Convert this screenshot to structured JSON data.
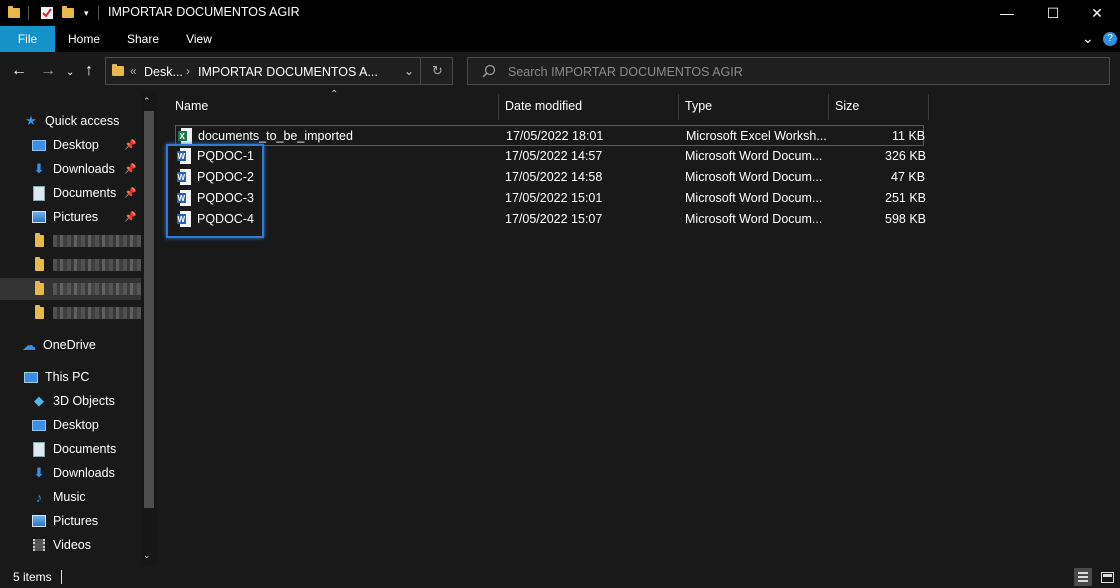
{
  "window": {
    "title": "IMPORTAR DOCUMENTOS AGIR",
    "minimize": "—",
    "maximize": "☐",
    "close": "✕"
  },
  "ribbon": {
    "tabs": [
      "File",
      "Home",
      "Share",
      "View"
    ]
  },
  "address": {
    "prefix": "«",
    "crumb1": "Desk...",
    "crumb2": "IMPORTAR DOCUMENTOS A...",
    "search_placeholder": "Search IMPORTAR DOCUMENTOS AGIR"
  },
  "nav": {
    "quick_access": "Quick access",
    "quick_items": [
      "Desktop",
      "Downloads",
      "Documents",
      "Pictures"
    ],
    "onedrive": "OneDrive",
    "this_pc": "This PC",
    "pc_items": [
      "3D Objects",
      "Desktop",
      "Documents",
      "Downloads",
      "Music",
      "Pictures",
      "Videos"
    ]
  },
  "columns": {
    "name": "Name",
    "date": "Date modified",
    "type": "Type",
    "size": "Size"
  },
  "files": [
    {
      "name": "documents_to_be_imported",
      "date": "17/05/2022 18:01",
      "type": "Microsoft Excel Worksh...",
      "size": "11 KB",
      "kind": "excel-icon"
    },
    {
      "name": "PQDOC-1",
      "date": "17/05/2022 14:57",
      "type": "Microsoft Word Docum...",
      "size": "326 KB",
      "kind": "word-icon"
    },
    {
      "name": "PQDOC-2",
      "date": "17/05/2022 14:58",
      "type": "Microsoft Word Docum...",
      "size": "47 KB",
      "kind": "word-icon"
    },
    {
      "name": "PQDOC-3",
      "date": "17/05/2022 15:01",
      "type": "Microsoft Word Docum...",
      "size": "251 KB",
      "kind": "word-icon"
    },
    {
      "name": "PQDOC-4",
      "date": "17/05/2022 15:07",
      "type": "Microsoft Word Docum...",
      "size": "598 KB",
      "kind": "word-icon"
    }
  ],
  "status": {
    "item_count": "5 items"
  },
  "colors": {
    "file_tab": "#1592c8",
    "highlight": "#2d7bd6",
    "folder": "#e8b84a"
  }
}
